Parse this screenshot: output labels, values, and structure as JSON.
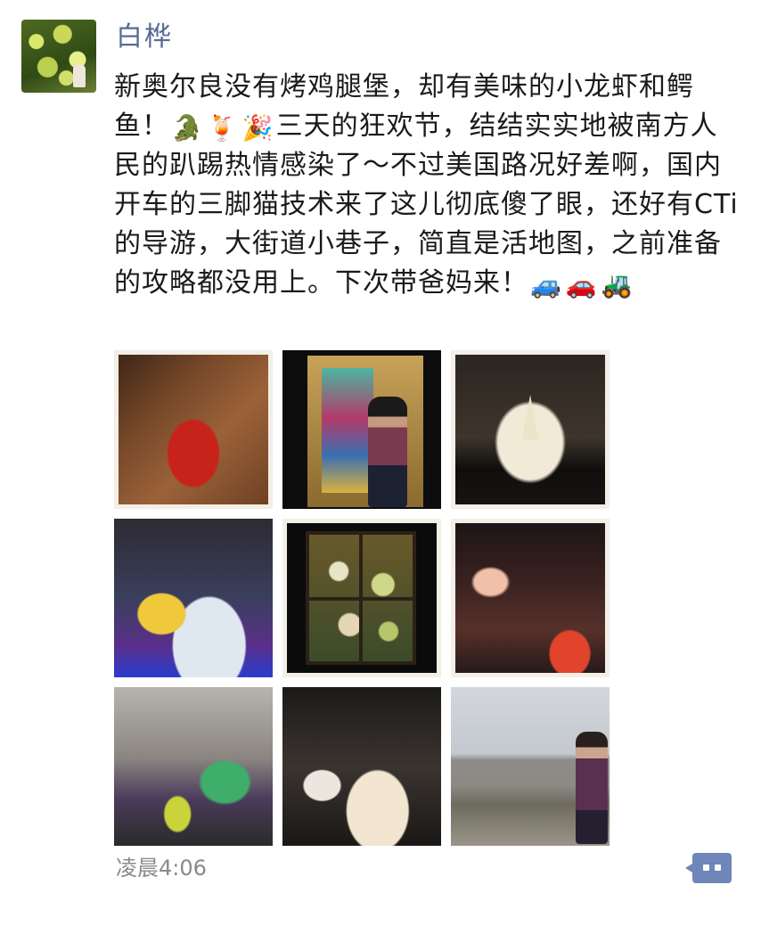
{
  "post": {
    "author": "白桦",
    "text_part1": "新奥尔良没有烤鸡腿堡，却有美味的小龙虾和鳄鱼！",
    "emoji_1": "🐊",
    "emoji_2": "🍹",
    "emoji_3": "🎉",
    "text_part2": "三天的狂欢节，结结实实地被南方人民的趴踢热情感染了～不过美国路况好差啊，国内开车的三脚猫技术来了这儿彻底傻了眼，还好有CTi的导游，大街道小巷子，简直是活地图，之前准备的攻略都没用上。下次带爸妈来！",
    "emoji_4": "🚙",
    "emoji_5": "🚗",
    "emoji_6": "🚜",
    "timestamp": "凌晨4:06"
  },
  "photos": [
    {
      "icon": "drink-photo"
    },
    {
      "icon": "mural-door-photo"
    },
    {
      "icon": "cathedral-night-photo"
    },
    {
      "icon": "parade-float-photo"
    },
    {
      "icon": "window-display-photo"
    },
    {
      "icon": "street-crowd-photo"
    },
    {
      "icon": "parade-street-photo"
    },
    {
      "icon": "restaurant-food-photo"
    },
    {
      "icon": "riverside-photo"
    }
  ]
}
